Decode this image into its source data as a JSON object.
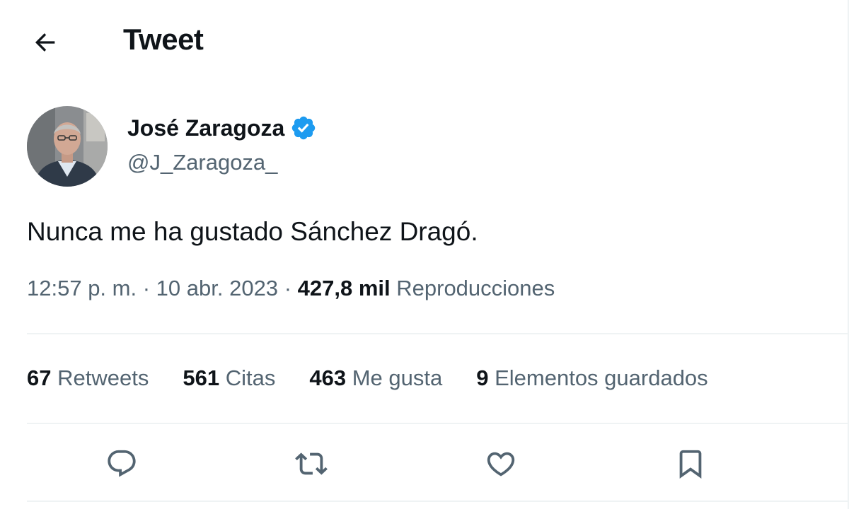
{
  "header": {
    "title": "Tweet",
    "back_icon": "arrow-left-icon"
  },
  "author": {
    "name": "José Zaragoza",
    "handle": "@J_Zaragoza_",
    "verified": true,
    "verified_color": "#1d9bf0"
  },
  "tweet": {
    "text": "Nunca me ha gustado Sánchez Dragó.",
    "time": "12:57 p. m.",
    "separator": "·",
    "date": "10 abr. 2023",
    "views_count": "427,8 mil",
    "views_label": "Reproducciones"
  },
  "stats": [
    {
      "count": "67",
      "label": "Retweets"
    },
    {
      "count": "561",
      "label": "Citas"
    },
    {
      "count": "463",
      "label": "Me gusta"
    },
    {
      "count": "9",
      "label": "Elementos guardados"
    }
  ],
  "actions": [
    {
      "name": "reply",
      "icon": "speech-bubble-icon"
    },
    {
      "name": "retweet",
      "icon": "retweet-arrows-icon"
    },
    {
      "name": "like",
      "icon": "heart-icon"
    },
    {
      "name": "bookmark",
      "icon": "bookmark-icon"
    }
  ],
  "colors": {
    "text_primary": "#0f1419",
    "text_secondary": "#536471",
    "divider": "#eff3f4",
    "accent": "#1d9bf0"
  }
}
